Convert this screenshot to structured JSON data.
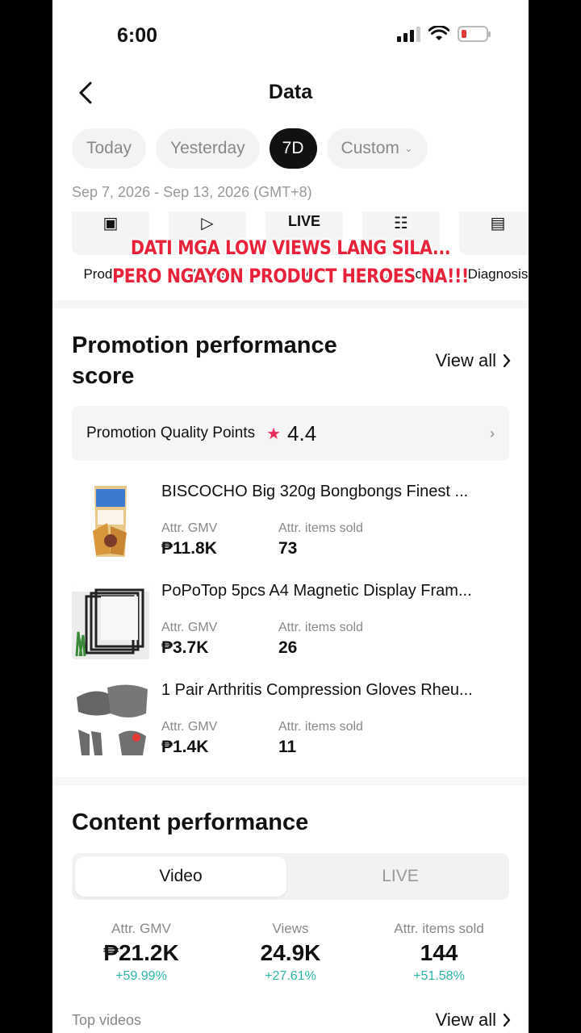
{
  "status_bar": {
    "time": "6:00"
  },
  "header": {
    "title": "Data"
  },
  "date_filters": {
    "options": [
      "Today",
      "Yesterday",
      "7D",
      "Custom"
    ],
    "selected": "7D",
    "range": "Sep 7, 2026 - Sep 13, 2026 (GMT+8)"
  },
  "tools": [
    {
      "label": "Products",
      "icon": "products-icon"
    },
    {
      "label": "Videos",
      "icon": "video-icon"
    },
    {
      "label": "LIVE",
      "icon": "live-icon"
    },
    {
      "label": "Audience",
      "icon": "audience-icon"
    },
    {
      "label": "Diagnosis",
      "icon": "diagnosis-icon"
    }
  ],
  "overlay_caption": {
    "line1": "DATI MGA LOW VIEWS LANG SILA...",
    "line2": "PERO NGAYON PRODUCT HEROES NA!!!"
  },
  "promotion": {
    "title": "Promotion performance score",
    "view_all": "View all",
    "quality_label": "Promotion Quality Points",
    "quality_score": "4.4",
    "gmv_label": "Attr. GMV",
    "items_label": "Attr. items sold",
    "products": [
      {
        "name": "BISCOCHO Big 320g Bongbongs Finest ...",
        "gmv": "₱11.8K",
        "items_sold": "73"
      },
      {
        "name": "PoPoTop 5pcs A4 Magnetic Display Fram...",
        "gmv": "₱3.7K",
        "items_sold": "26"
      },
      {
        "name": "1 Pair Arthritis Compression Gloves Rheu...",
        "gmv": "₱1.4K",
        "items_sold": "11"
      }
    ]
  },
  "content": {
    "title": "Content performance",
    "tabs": [
      "Video",
      "LIVE"
    ],
    "active_tab": "Video",
    "metrics": [
      {
        "label": "Attr. GMV",
        "value": "₱21.2K",
        "change": "+59.99%"
      },
      {
        "label": "Views",
        "value": "24.9K",
        "change": "+27.61%"
      },
      {
        "label": "Attr. items sold",
        "value": "144",
        "change": "+51.58%"
      }
    ],
    "top_videos_label": "Top videos",
    "view_all": "View all"
  },
  "colors": {
    "accent_star": "#ee2a5a",
    "positive_change": "#2ab5a8",
    "overlay_text": "#e8223a"
  }
}
